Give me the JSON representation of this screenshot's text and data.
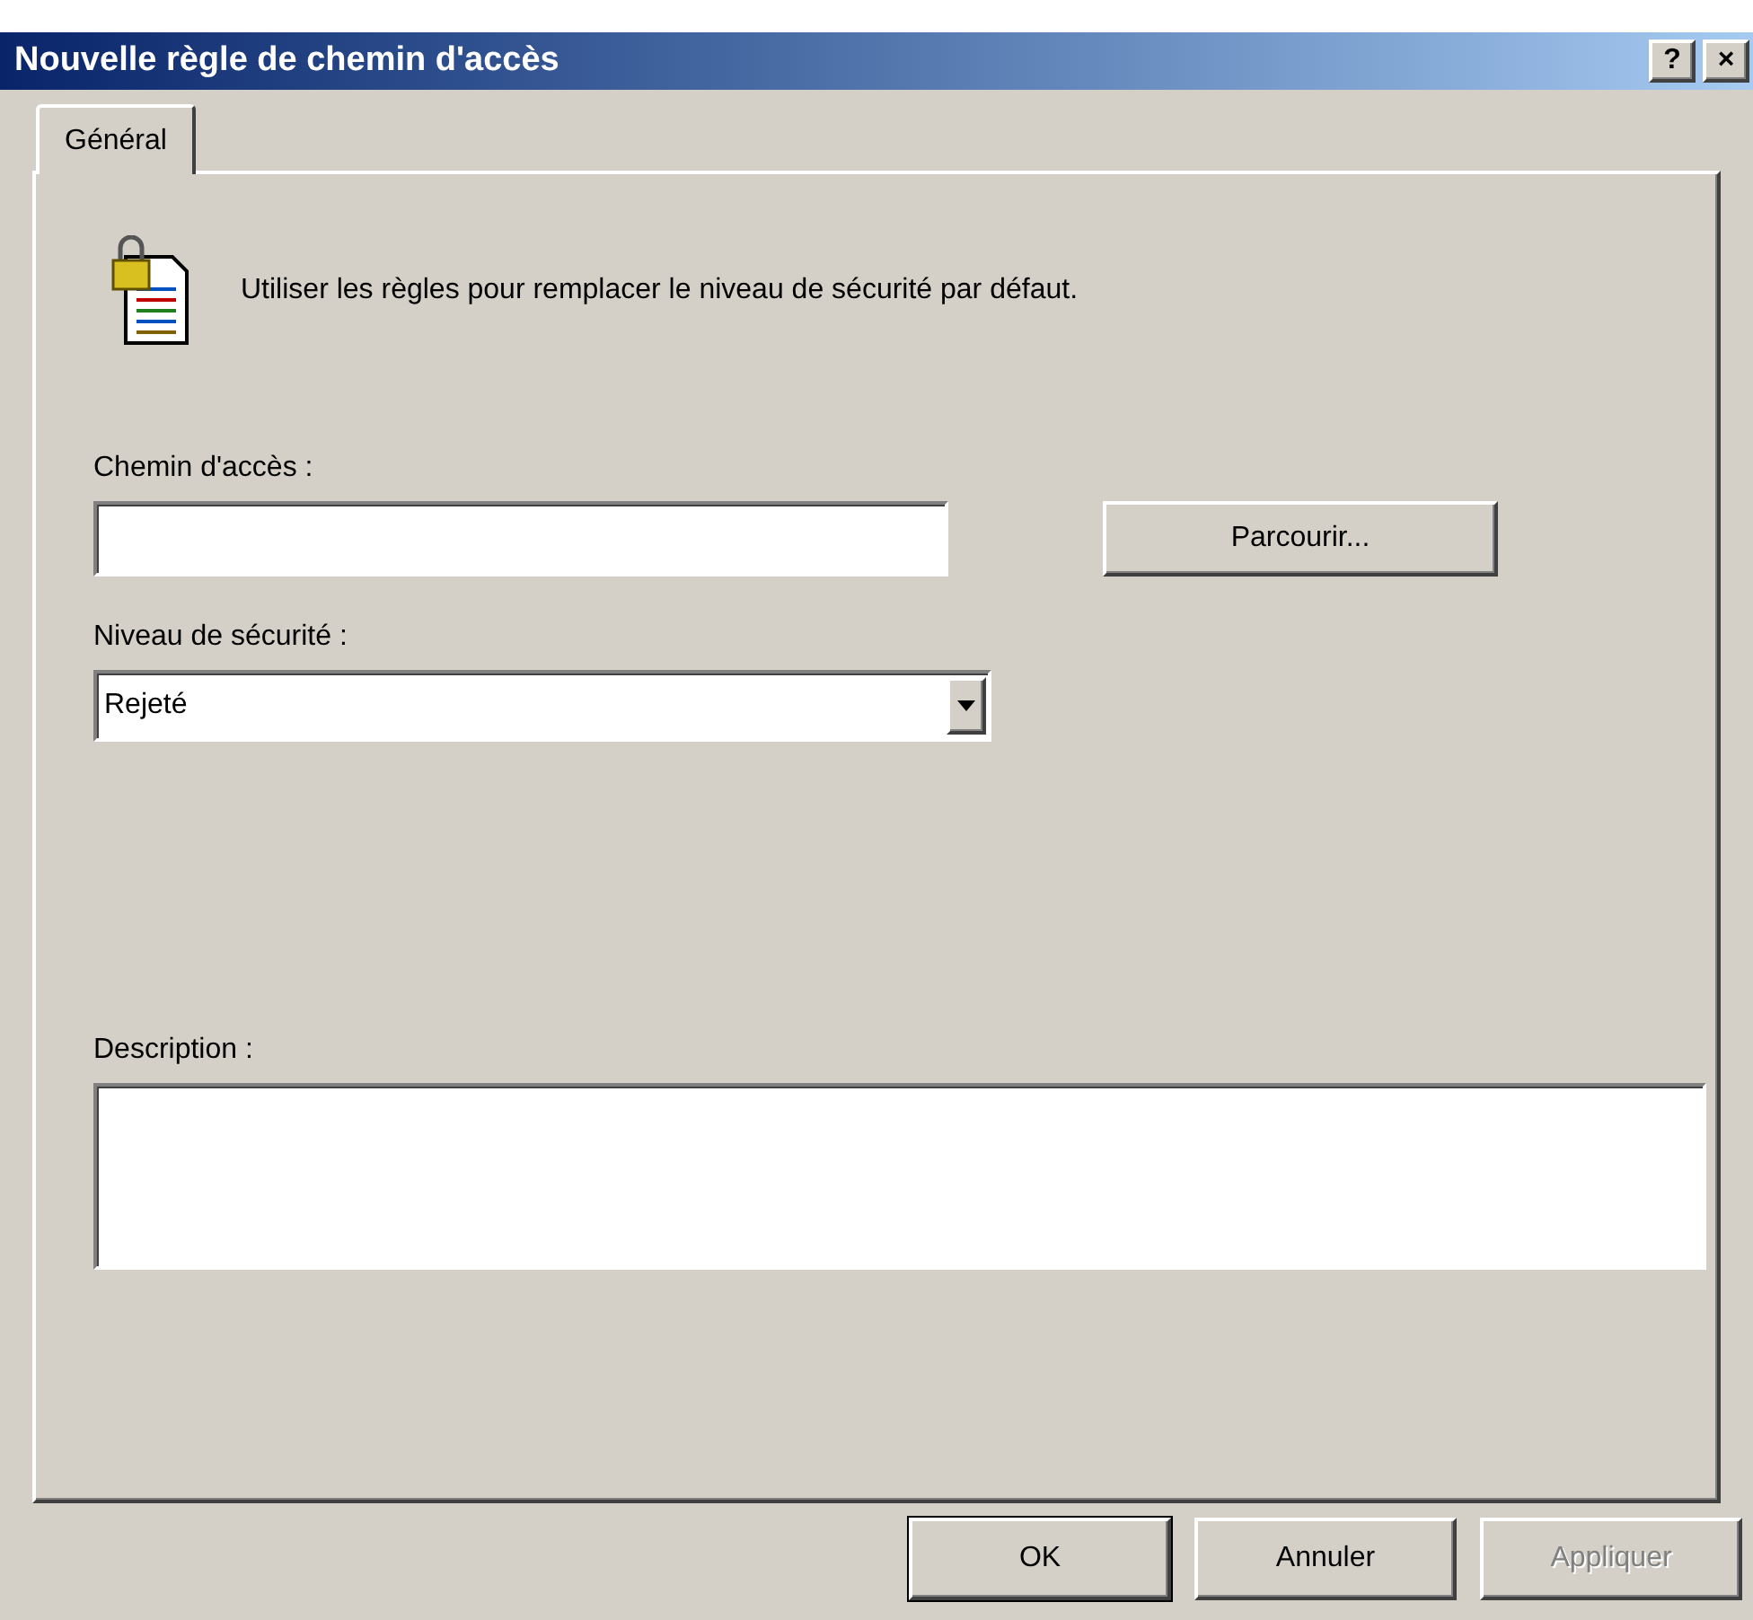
{
  "window": {
    "title": "Nouvelle règle de chemin d'accès",
    "title_buttons": [
      "?",
      "×"
    ]
  },
  "tabs": [
    {
      "label": "Général",
      "selected": true
    }
  ],
  "intro": "Utiliser les règles pour remplacer le niveau de sécurité par défaut.",
  "path": {
    "label": "Chemin d'accès :",
    "browse_button": "Parcourir..."
  },
  "security_level": {
    "label": "Niveau de sécurité :",
    "value": "Rejeté"
  },
  "description": {
    "label": "Description :"
  },
  "buttons": [
    {
      "label": "OK",
      "default": true,
      "disabled": false
    },
    {
      "label": "Annuler",
      "default": false,
      "disabled": false
    },
    {
      "label": "Appliquer",
      "default": false,
      "disabled": true
    }
  ]
}
